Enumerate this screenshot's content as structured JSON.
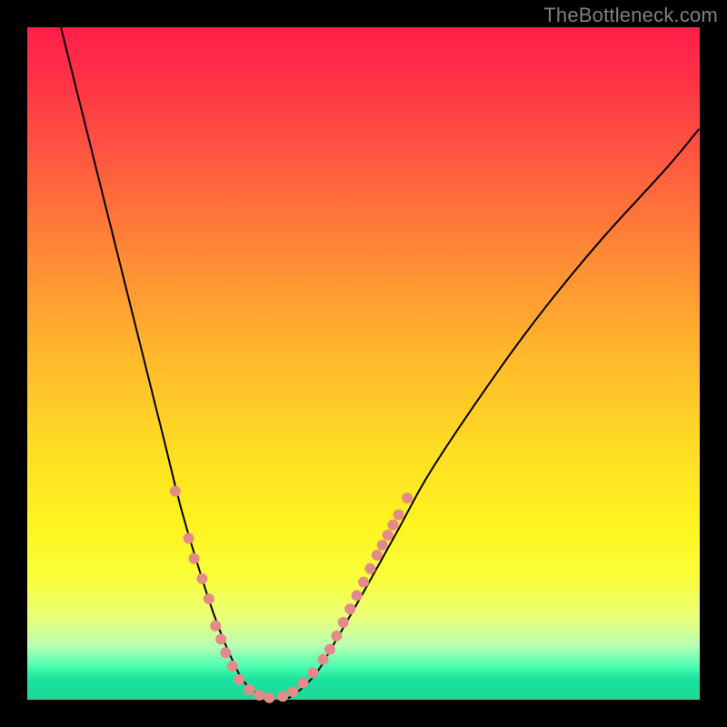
{
  "watermark": "TheBottleneck.com",
  "chart_data": {
    "type": "line",
    "title": "",
    "xlabel": "",
    "ylabel": "",
    "xlim": [
      0,
      100
    ],
    "ylim": [
      0,
      100
    ],
    "grid": false,
    "background_gradient": [
      "#ff1f4a",
      "#ff5a3f",
      "#ffb62c",
      "#fff41f",
      "#b7ffb4",
      "#1fd793"
    ],
    "series": [
      {
        "name": "bottleneck-curve",
        "x": [
          5,
          10,
          15,
          20,
          23,
          26,
          28,
          30,
          32,
          34,
          36,
          38,
          40,
          43,
          46,
          50,
          55,
          60,
          68,
          76,
          85,
          95,
          100
        ],
        "y": [
          100,
          80,
          60,
          40,
          28,
          18,
          12,
          7,
          3,
          1,
          0,
          0,
          1,
          4,
          9,
          16,
          25,
          34,
          46,
          57,
          68,
          79,
          85
        ]
      }
    ],
    "dot_groups": [
      {
        "name": "left-arm-dots",
        "color": "#e58a8a",
        "radius_px": 6,
        "points": [
          {
            "x": 22.0,
            "y": 31
          },
          {
            "x": 24.0,
            "y": 24
          },
          {
            "x": 24.8,
            "y": 21
          },
          {
            "x": 26.0,
            "y": 18
          },
          {
            "x": 27.0,
            "y": 15
          },
          {
            "x": 28.0,
            "y": 11
          },
          {
            "x": 28.8,
            "y": 9
          },
          {
            "x": 29.5,
            "y": 7
          },
          {
            "x": 30.5,
            "y": 5
          },
          {
            "x": 31.5,
            "y": 3
          },
          {
            "x": 33.0,
            "y": 1.5
          },
          {
            "x": 34.5,
            "y": 0.7
          },
          {
            "x": 36.0,
            "y": 0.3
          }
        ]
      },
      {
        "name": "right-arm-dots",
        "color": "#e58a8a",
        "radius_px": 6,
        "points": [
          {
            "x": 38.0,
            "y": 0.5
          },
          {
            "x": 39.5,
            "y": 1.2
          },
          {
            "x": 41.0,
            "y": 2.5
          },
          {
            "x": 42.5,
            "y": 4.0
          },
          {
            "x": 44.0,
            "y": 6.0
          },
          {
            "x": 45.0,
            "y": 7.5
          },
          {
            "x": 46.0,
            "y": 9.5
          },
          {
            "x": 47.0,
            "y": 11.5
          },
          {
            "x": 48.0,
            "y": 13.5
          },
          {
            "x": 49.0,
            "y": 15.5
          },
          {
            "x": 50.0,
            "y": 17.5
          },
          {
            "x": 51.0,
            "y": 19.5
          },
          {
            "x": 52.0,
            "y": 21.5
          },
          {
            "x": 52.8,
            "y": 23.0
          },
          {
            "x": 53.6,
            "y": 24.5
          },
          {
            "x": 54.4,
            "y": 26.0
          },
          {
            "x": 55.2,
            "y": 27.5
          },
          {
            "x": 56.5,
            "y": 30.0
          }
        ]
      }
    ]
  }
}
